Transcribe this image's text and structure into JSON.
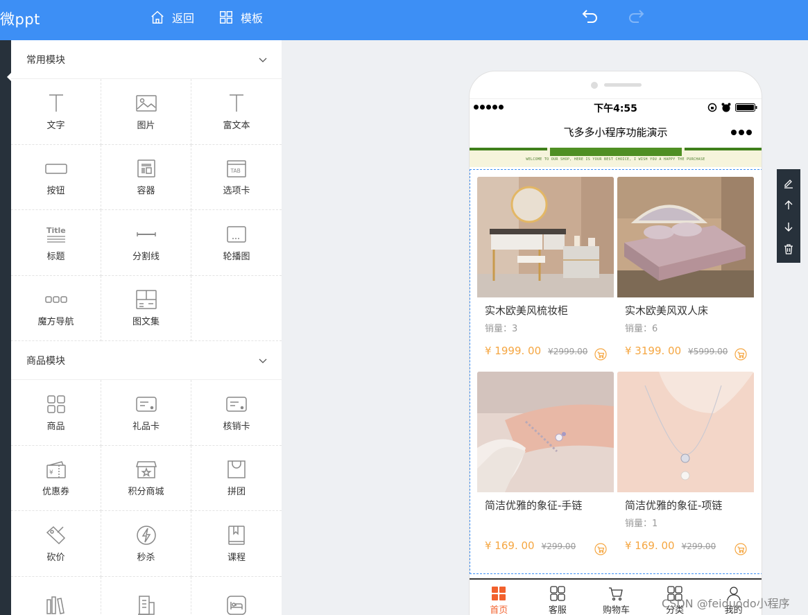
{
  "topbar": {
    "logo": "微ppt",
    "back_label": "返回",
    "template_label": "模板"
  },
  "panel": {
    "common": {
      "title": "常用模块",
      "items": [
        {
          "label": "文字",
          "icon": "text-icon"
        },
        {
          "label": "图片",
          "icon": "image-icon"
        },
        {
          "label": "富文本",
          "icon": "rich-text-icon"
        },
        {
          "label": "按钮",
          "icon": "button-icon"
        },
        {
          "label": "容器",
          "icon": "container-icon"
        },
        {
          "label": "选项卡",
          "icon": "tab-icon"
        },
        {
          "label": "标题",
          "icon": "title-icon"
        },
        {
          "label": "分割线",
          "icon": "divider-icon"
        },
        {
          "label": "轮播图",
          "icon": "carousel-icon"
        },
        {
          "label": "魔方导航",
          "icon": "cube-nav-icon"
        },
        {
          "label": "图文集",
          "icon": "image-text-icon"
        }
      ]
    },
    "goods": {
      "title": "商品模块",
      "items": [
        {
          "label": "商品",
          "icon": "goods-icon"
        },
        {
          "label": "礼品卡",
          "icon": "gift-card-icon"
        },
        {
          "label": "核销卡",
          "icon": "verify-card-icon"
        },
        {
          "label": "优惠券",
          "icon": "coupon-icon"
        },
        {
          "label": "积分商城",
          "icon": "points-mall-icon"
        },
        {
          "label": "拼团",
          "icon": "group-buy-icon"
        },
        {
          "label": "砍价",
          "icon": "bargain-icon"
        },
        {
          "label": "秒杀",
          "icon": "flash-sale-icon"
        },
        {
          "label": "课程",
          "icon": "course-icon"
        }
      ]
    }
  },
  "phone": {
    "time": "下午4:55",
    "title": "飞多多小程序功能演示",
    "banner_text": "WELCOME TO OUR SHOP, HERE IS YOUR BEST CHOICE, I WISH YOU A HAPPY THE PURCHASE",
    "products": [
      {
        "name": "实木欧美风梳妆柜",
        "sales": "销量：3",
        "price": "¥ 1999. 00",
        "old_price": "¥2999.00"
      },
      {
        "name": "实木欧美风双人床",
        "sales": "销量：6",
        "price": "¥ 3199. 00",
        "old_price": "¥5999.00"
      },
      {
        "name": "简洁优雅的象征-手链",
        "sales": "",
        "price": "¥ 169. 00",
        "old_price": "¥299.00"
      },
      {
        "name": "简洁优雅的象征-项链",
        "sales": "销量：1",
        "price": "¥ 169. 00",
        "old_price": "¥299.00"
      }
    ],
    "tabs": [
      {
        "label": "首页",
        "icon": "home-icon"
      },
      {
        "label": "客服",
        "icon": "service-icon"
      },
      {
        "label": "购物车",
        "icon": "cart-icon"
      },
      {
        "label": "分类",
        "icon": "category-icon"
      },
      {
        "label": "我的",
        "icon": "user-icon"
      }
    ]
  },
  "watermark": "CSDN @feiduodo小程序",
  "colors": {
    "topbar": "#3d8ff5",
    "price": "#f5a641",
    "tab_active": "#f2612d",
    "dark": "#27313b"
  }
}
